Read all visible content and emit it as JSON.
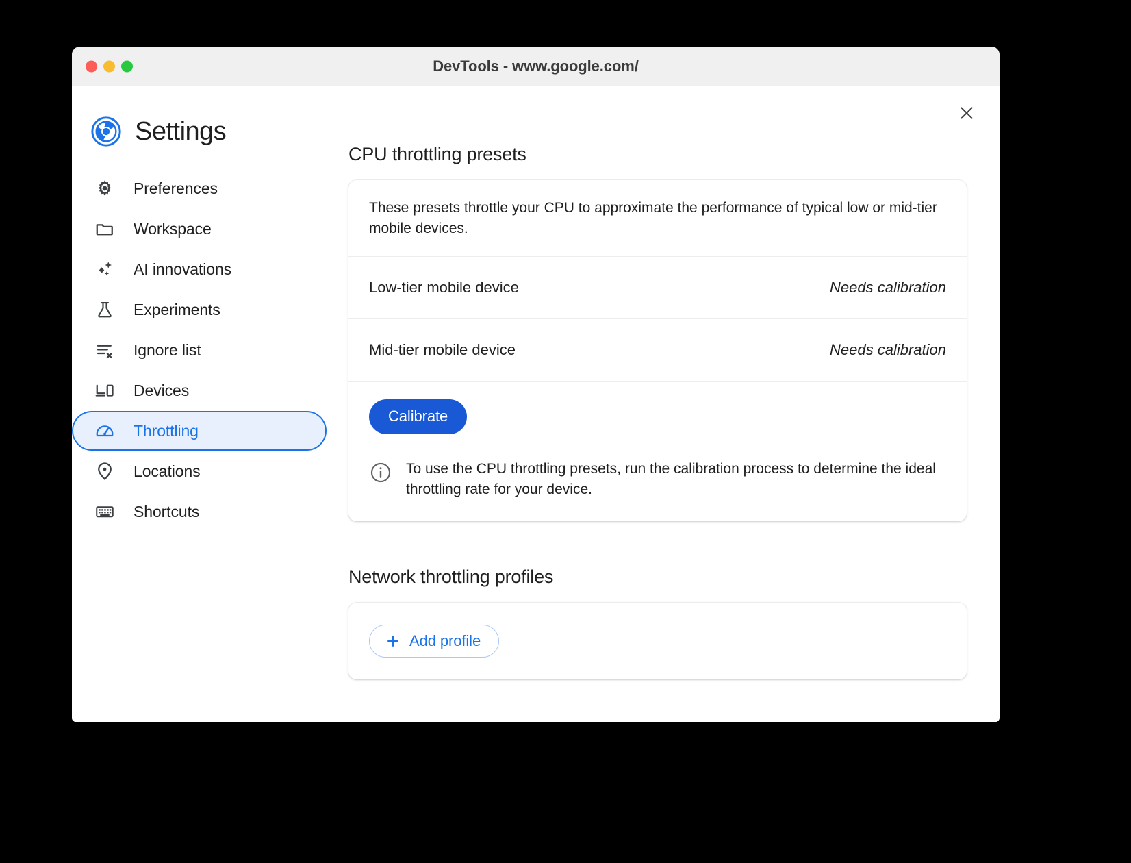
{
  "window": {
    "title": "DevTools - www.google.com/",
    "traffic_lights": [
      "close",
      "minimize",
      "zoom"
    ],
    "close_dialog_label": "Close"
  },
  "header": {
    "logo": "chrome-devtools-logo",
    "title": "Settings"
  },
  "sidebar": {
    "items": [
      {
        "label": "Preferences",
        "icon": "gear-icon",
        "selected": false
      },
      {
        "label": "Workspace",
        "icon": "folder-icon",
        "selected": false
      },
      {
        "label": "AI innovations",
        "icon": "sparkle-icon",
        "selected": false
      },
      {
        "label": "Experiments",
        "icon": "flask-icon",
        "selected": false
      },
      {
        "label": "Ignore list",
        "icon": "list-x-icon",
        "selected": false
      },
      {
        "label": "Devices",
        "icon": "devices-icon",
        "selected": false
      },
      {
        "label": "Throttling",
        "icon": "speedometer-icon",
        "selected": true
      },
      {
        "label": "Locations",
        "icon": "pin-icon",
        "selected": false
      },
      {
        "label": "Shortcuts",
        "icon": "keyboard-icon",
        "selected": false
      }
    ]
  },
  "main": {
    "cpu_section": {
      "title": "CPU throttling presets",
      "description": "These presets throttle your CPU to approximate the performance of typical low or mid-tier mobile devices.",
      "presets": [
        {
          "name": "Low-tier mobile device",
          "status": "Needs calibration"
        },
        {
          "name": "Mid-tier mobile device",
          "status": "Needs calibration"
        }
      ],
      "calibrate_label": "Calibrate",
      "info_icon": "info-icon",
      "info_text": "To use the CPU throttling presets, run the calibration process to determine the ideal throttling rate for your device."
    },
    "network_section": {
      "title": "Network throttling profiles",
      "add_profile_label": "Add profile",
      "add_profile_icon": "plus-icon"
    }
  },
  "colors": {
    "accent_blue": "#1a73e8",
    "button_blue": "#1a59d6",
    "selected_bg": "#e8f0fe",
    "titlebar_bg": "#f0f0f1",
    "text_primary": "#1f1f1f",
    "traffic_red": "#fc5e57",
    "traffic_amber": "#f9bb2f",
    "traffic_green": "#28c840"
  }
}
